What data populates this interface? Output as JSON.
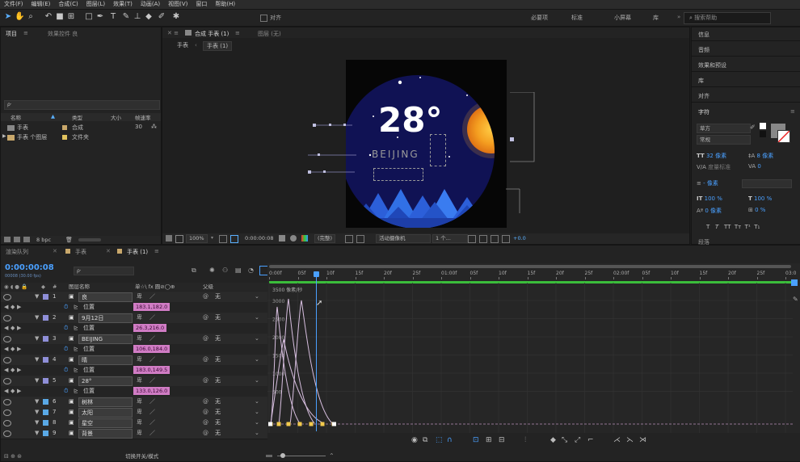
{
  "menu": [
    "文件(F)",
    "编辑(E)",
    "合成(C)",
    "图层(L)",
    "效果(T)",
    "动画(A)",
    "视图(V)",
    "窗口",
    "帮助(H)"
  ],
  "toolbar": {
    "snap_label": "对齐"
  },
  "workspaces": [
    "必要项",
    "标准",
    "小屏幕",
    "库"
  ],
  "search_placeholder": "搜索帮助",
  "project": {
    "tab": "项目",
    "effects_tab": "效果控件 良",
    "search_placeholder": "ρ·",
    "columns": [
      "名称",
      "类型",
      "大小",
      "帧速率"
    ],
    "items": [
      {
        "name": "手表",
        "type": "合成",
        "fps": "30"
      },
      {
        "name": "手表 个图层",
        "type": "文件夹",
        "fps": ""
      }
    ],
    "bpc": "8 bpc"
  },
  "composition": {
    "tab": "合成 手表 (1)",
    "layer_tab": "图层 (无)",
    "breadcrumbs": [
      "手表",
      "手表 (1)"
    ],
    "temperature": "28°",
    "city": "BEIJING",
    "zoom": "100%",
    "timecode": "0:00:00:08",
    "quality": "(完整)",
    "camera": "活动摄像机",
    "views": "1 个...",
    "exposure": "+0.0"
  },
  "right_panel": {
    "sections": [
      "信息",
      "音频",
      "效果和预设",
      "库",
      "对齐"
    ],
    "character_title": "字符",
    "font_family": "草方",
    "font_style": "常规",
    "font_size": "32 像素",
    "leading": "8 像素",
    "tracking_label": "度量标准",
    "tracking": "0",
    "stroke_width": "- 像素",
    "vscale": "100 %",
    "hscale": "100 %",
    "baseline": "0 像素",
    "tsume": "0 %",
    "styles": [
      "T",
      "T",
      "TT",
      "Tт",
      "T¹",
      "T₁"
    ],
    "paragraph_title": "段落"
  },
  "timeline": {
    "render_queue_tab": "渲染队列",
    "tab1": "手表",
    "tab2": "手表 (1)",
    "timecode": "0:00:00:08",
    "frame_info": "00008 (30.00 fps)",
    "columns": {
      "num": "#",
      "name": "图层名称",
      "switches": "单☆\\ fx 圓⊘◯⊕",
      "parent": "父级"
    },
    "rows": [
      {
        "kind": "layer",
        "num": "1",
        "name": "良",
        "parent": "无",
        "color": "#8f8fd8"
      },
      {
        "kind": "prop",
        "name": "位置",
        "value": "183.1,182.0"
      },
      {
        "kind": "layer",
        "num": "2",
        "name": "9月12日",
        "parent": "无",
        "color": "#8f8fd8"
      },
      {
        "kind": "prop",
        "name": "位置",
        "value": "26.3,216.0"
      },
      {
        "kind": "layer",
        "num": "3",
        "name": "BEIJING",
        "parent": "无",
        "color": "#8f8fd8"
      },
      {
        "kind": "prop",
        "name": "位置",
        "value": "106.0,184.0"
      },
      {
        "kind": "layer",
        "num": "4",
        "name": "晴",
        "parent": "无",
        "color": "#8f8fd8"
      },
      {
        "kind": "prop",
        "name": "位置",
        "value": "183.0,149.5"
      },
      {
        "kind": "layer",
        "num": "5",
        "name": "28°",
        "parent": "无",
        "color": "#8f8fd8"
      },
      {
        "kind": "prop",
        "name": "位置",
        "value": "133.0,126.0"
      },
      {
        "kind": "layer",
        "num": "6",
        "name": "树林",
        "parent": "无",
        "color": "#5aa9e6"
      },
      {
        "kind": "layer",
        "num": "7",
        "name": "太阳",
        "parent": "无",
        "color": "#5aa9e6"
      },
      {
        "kind": "layer",
        "num": "8",
        "name": "星空",
        "parent": "无",
        "color": "#5aa9e6"
      },
      {
        "kind": "layer",
        "num": "9",
        "name": "背景",
        "parent": "无",
        "color": "#5aa9e6"
      }
    ],
    "ruler_labels": [
      "0:00f",
      "05f",
      "10f",
      "15f",
      "20f",
      "25f",
      "01:00f",
      "05f",
      "10f",
      "15f",
      "20f",
      "25f",
      "02:00f",
      "05f",
      "10f",
      "15f",
      "20f",
      "25f",
      "03:0"
    ],
    "graph_unit": "3500 像素/秒",
    "graph_labels": [
      "3000",
      "2500",
      "2000",
      "1500",
      "1000",
      "500"
    ],
    "footer_toggle": "切换开关/模式"
  }
}
